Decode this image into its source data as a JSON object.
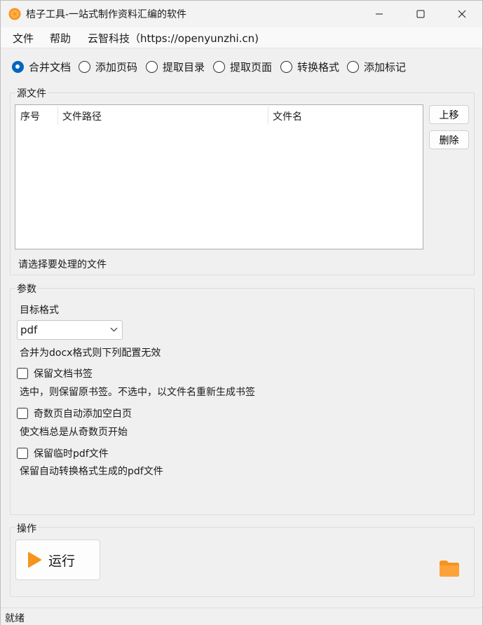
{
  "window": {
    "title": "桔子工具-一站式制作资料汇编的软件",
    "controls": {
      "minimize": "minimize-icon",
      "maximize": "maximize-icon",
      "close": "close-icon"
    }
  },
  "menu": [
    "文件",
    "帮助",
    "云智科技（https://openyunzhi.cn)"
  ],
  "modes": {
    "options": [
      "合并文档",
      "添加页码",
      "提取目录",
      "提取页面",
      "转换格式",
      "添加标记"
    ],
    "selected": "合并文档"
  },
  "source": {
    "group_title": "源文件",
    "columns": [
      "序号",
      "文件路径",
      "文件名"
    ],
    "rows": [],
    "move_up_label": "上移",
    "delete_label": "删除",
    "hint": "请选择要处理的文件"
  },
  "params": {
    "group_title": "参数",
    "target_format_label": "目标格式",
    "target_format_value": "pdf",
    "docx_note": "合并为docx格式则下列配置无效",
    "keep_bookmarks_label": "保留文档书签",
    "keep_bookmarks_checked": false,
    "keep_bookmarks_desc": "选中，则保留原书签。不选中，以文件名重新生成书签",
    "odd_blank_label": "奇数页自动添加空白页",
    "odd_blank_checked": false,
    "odd_blank_desc": "使文档总是从奇数页开始",
    "keep_temp_pdf_label": "保留临时pdf文件",
    "keep_temp_pdf_checked": false,
    "keep_temp_pdf_desc": "保留自动转换格式生成的pdf文件"
  },
  "actions": {
    "group_title": "操作",
    "run_label": "运行",
    "run_icon": "play-icon",
    "folder_icon": "folder-icon"
  },
  "status": {
    "text": "就绪"
  },
  "colors": {
    "accent": "#0067c0",
    "icon_orange": "#f7941d"
  }
}
